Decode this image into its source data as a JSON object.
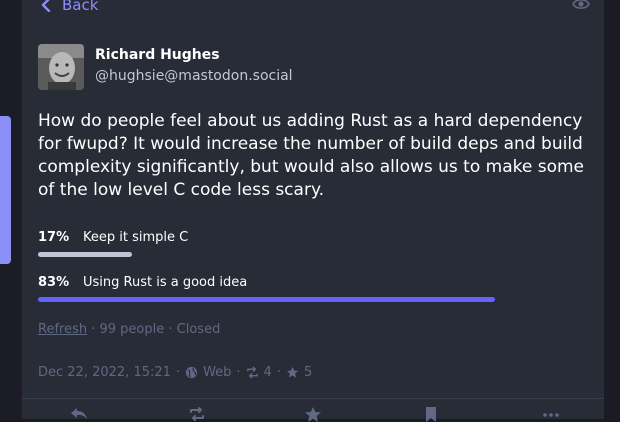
{
  "nav": {
    "back_label": "Back"
  },
  "post": {
    "author_name": "Richard Hughes",
    "author_handle": "@hughsie@mastodon.social",
    "content": "How do people feel about us adding Rust as a hard dependency for fwupd? It would increase the number of build deps and build complexity significantly, but would also allows us to make some of the low level C code less scary.",
    "poll": {
      "options": [
        {
          "percent_label": "17%",
          "label": "Keep it simple C",
          "fraction": 0.17,
          "winner": false
        },
        {
          "percent_label": "83%",
          "label": "Using Rust is a good idea",
          "fraction": 0.83,
          "winner": true
        }
      ],
      "refresh_label": "Refresh",
      "voters": "99 people",
      "status": "Closed"
    },
    "meta": {
      "date": "Dec 22, 2022, 15:21",
      "visibility": "Web",
      "boosts": "4",
      "favourites": "5"
    }
  },
  "icons": {
    "back": "chevron-left-icon",
    "visibility": "eye-icon",
    "globe": "globe-icon",
    "boost": "retweet-icon",
    "favourite": "star-icon",
    "reply": "reply-icon",
    "bookmark": "bookmark-icon"
  },
  "colors": {
    "accent": "#8c8dff",
    "bar_winner": "#6364ff",
    "bar_other": "#c0c5d8",
    "muted": "#606984"
  }
}
